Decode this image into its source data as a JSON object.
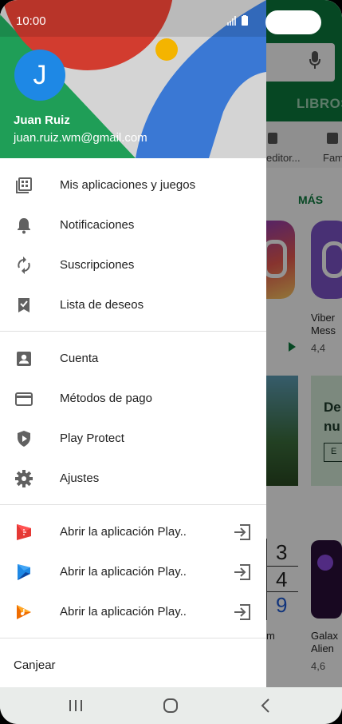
{
  "status": {
    "time": "10:00"
  },
  "header": {
    "avatar_letter": "J",
    "name": "Juan Ruiz",
    "email": "juan.ruiz.wm@gmail.com"
  },
  "menu_section1": [
    {
      "label": "Mis aplicaciones y juegos",
      "icon": "apps-grid-icon"
    },
    {
      "label": "Notificaciones",
      "icon": "bell-icon"
    },
    {
      "label": "Suscripciones",
      "icon": "refresh-icon"
    },
    {
      "label": "Lista de deseos",
      "icon": "bookmark-check-icon"
    }
  ],
  "menu_section2": [
    {
      "label": "Cuenta",
      "icon": "account-box-icon"
    },
    {
      "label": "Métodos de pago",
      "icon": "credit-card-icon"
    },
    {
      "label": "Play Protect",
      "icon": "shield-play-icon"
    },
    {
      "label": "Ajustes",
      "icon": "gear-icon"
    }
  ],
  "menu_section3": [
    {
      "label": "Abrir la aplicación Play..",
      "icon": "play-movies-icon"
    },
    {
      "label": "Abrir la aplicación Play..",
      "icon": "play-books-icon"
    },
    {
      "label": "Abrir la aplicación Play..",
      "icon": "play-music-icon"
    }
  ],
  "redeem_label": "Canjear",
  "background": {
    "tab_label": "LIBROS",
    "chip1": "editor...",
    "chip2": "Fam",
    "more_label": "MÁS",
    "app1_name_line1": "Viber",
    "app1_name_line2": "Mess",
    "app1_rating": "4,4",
    "card_line1": "De",
    "card_line2": "nu",
    "card_button": "E",
    "sudoku_digits": [
      "3",
      "4",
      "9"
    ],
    "partial_text": "m",
    "app2_name_line1": "Galax",
    "app2_name_line2": "Alien",
    "app2_rating": "4,6"
  },
  "colors": {
    "brand_green": "#0b7a3d",
    "avatar_blue": "#1e88e5",
    "header_red": "#d23c2f",
    "header_blue": "#3a78d4",
    "header_green": "#1f9e57",
    "header_yellow": "#f4b400"
  }
}
